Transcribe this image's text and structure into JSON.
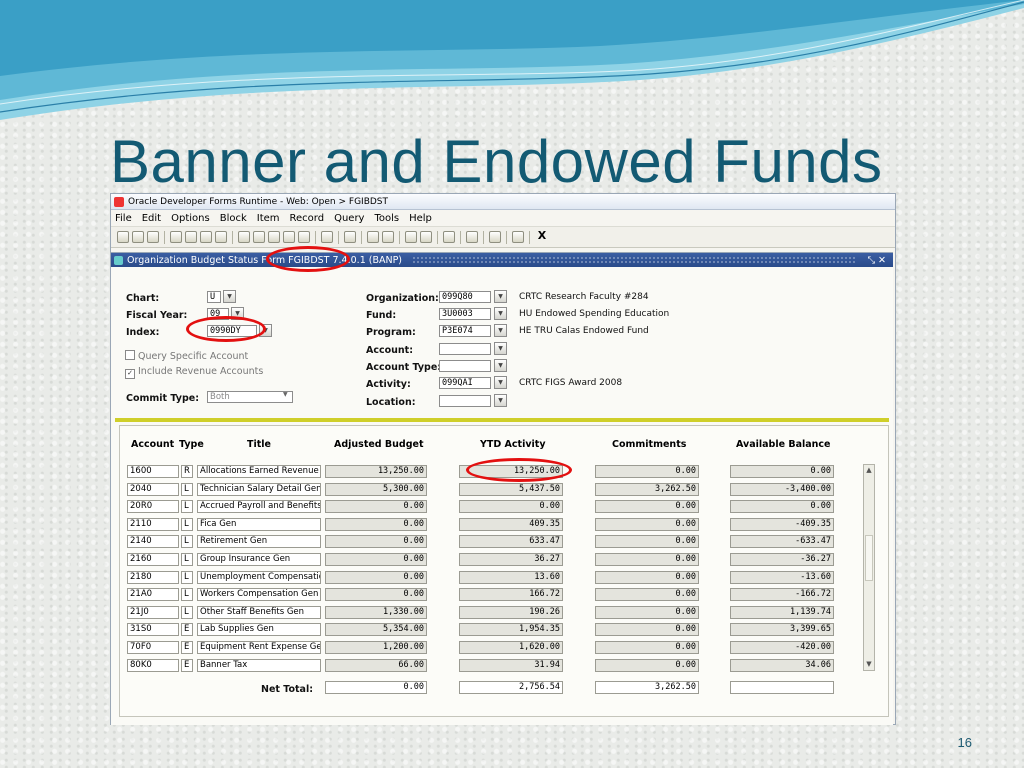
{
  "slide": {
    "title": "Banner and Endowed Funds",
    "page_number": "16"
  },
  "window": {
    "title": "Oracle Developer Forms Runtime - Web:  Open > FGIBDST"
  },
  "menu": [
    "File",
    "Edit",
    "Options",
    "Block",
    "Item",
    "Record",
    "Query",
    "Tools",
    "Help"
  ],
  "toolbar": {
    "exit_label": "X"
  },
  "form": {
    "title": "Organization Budget Status Form  FGIBDST  7.4.0.1  (BANP)",
    "key": {
      "chart_label": "Chart:",
      "chart_value": "U",
      "fiscal_year_label": "Fiscal Year:",
      "fiscal_year_value": "09",
      "index_label": "Index:",
      "index_value": "0990DY",
      "query_specific_label": "Query Specific Account",
      "include_revenue_label": "Include Revenue Accounts",
      "commit_type_label": "Commit Type:",
      "commit_type_value": "Both",
      "organization_label": "Organization:",
      "organization_value": "099Q80",
      "organization_desc": "CRTC Research Faculty #284",
      "fund_label": "Fund:",
      "fund_value": "3U0003",
      "fund_desc": "HU Endowed Spending Education",
      "program_label": "Program:",
      "program_value": "P3E074",
      "program_desc": "HE TRU Calas Endowed Fund",
      "account_label": "Account:",
      "account_value": "",
      "account_type_label": "Account Type:",
      "account_type_value": "",
      "activity_label": "Activity:",
      "activity_value": "099QAI",
      "activity_desc": "CRTC FIGS Award 2008",
      "location_label": "Location:",
      "location_value": ""
    },
    "columns": {
      "account": "Account",
      "type": "Type",
      "title": "Title",
      "adjusted_budget": "Adjusted Budget",
      "ytd_activity": "YTD Activity",
      "commitments": "Commitments",
      "available_balance": "Available Balance"
    },
    "rows": [
      {
        "account": "1600",
        "type": "R",
        "title": "Allocations Earned Revenue",
        "budget": "13,250.00",
        "ytd": "13,250.00",
        "commit": "0.00",
        "avail": "0.00"
      },
      {
        "account": "2040",
        "type": "L",
        "title": "Technician Salary Detail Gen",
        "budget": "5,300.00",
        "ytd": "5,437.50",
        "commit": "3,262.50",
        "avail": "-3,400.00"
      },
      {
        "account": "20R0",
        "type": "L",
        "title": "Accrued Payroll and Benefits",
        "budget": "0.00",
        "ytd": "0.00",
        "commit": "0.00",
        "avail": "0.00"
      },
      {
        "account": "2110",
        "type": "L",
        "title": "Fica Gen",
        "budget": "0.00",
        "ytd": "409.35",
        "commit": "0.00",
        "avail": "-409.35"
      },
      {
        "account": "2140",
        "type": "L",
        "title": "Retirement Gen",
        "budget": "0.00",
        "ytd": "633.47",
        "commit": "0.00",
        "avail": "-633.47"
      },
      {
        "account": "2160",
        "type": "L",
        "title": "Group Insurance Gen",
        "budget": "0.00",
        "ytd": "36.27",
        "commit": "0.00",
        "avail": "-36.27"
      },
      {
        "account": "2180",
        "type": "L",
        "title": "Unemployment Compensation",
        "budget": "0.00",
        "ytd": "13.60",
        "commit": "0.00",
        "avail": "-13.60"
      },
      {
        "account": "21A0",
        "type": "L",
        "title": "Workers Compensation Gen",
        "budget": "0.00",
        "ytd": "166.72",
        "commit": "0.00",
        "avail": "-166.72"
      },
      {
        "account": "21J0",
        "type": "L",
        "title": "Other Staff Benefits Gen",
        "budget": "1,330.00",
        "ytd": "190.26",
        "commit": "0.00",
        "avail": "1,139.74"
      },
      {
        "account": "31S0",
        "type": "E",
        "title": "Lab Supplies Gen",
        "budget": "5,354.00",
        "ytd": "1,954.35",
        "commit": "0.00",
        "avail": "3,399.65"
      },
      {
        "account": "70F0",
        "type": "E",
        "title": "Equipment Rent Expense Gen",
        "budget": "1,200.00",
        "ytd": "1,620.00",
        "commit": "0.00",
        "avail": "-420.00"
      },
      {
        "account": "80K0",
        "type": "E",
        "title": "Banner Tax",
        "budget": "66.00",
        "ytd": "31.94",
        "commit": "0.00",
        "avail": "34.06"
      }
    ],
    "net_total": {
      "label": "Net Total:",
      "budget": "0.00",
      "ytd": "2,756.54",
      "commit": "3,262.50",
      "avail": ""
    }
  },
  "colors": {
    "title": "#135a73",
    "form_titlebar": "#2a4b8a",
    "divider": "#cfcf2a",
    "highlight_ring": "#e31010",
    "selection": "#2b53b3"
  }
}
